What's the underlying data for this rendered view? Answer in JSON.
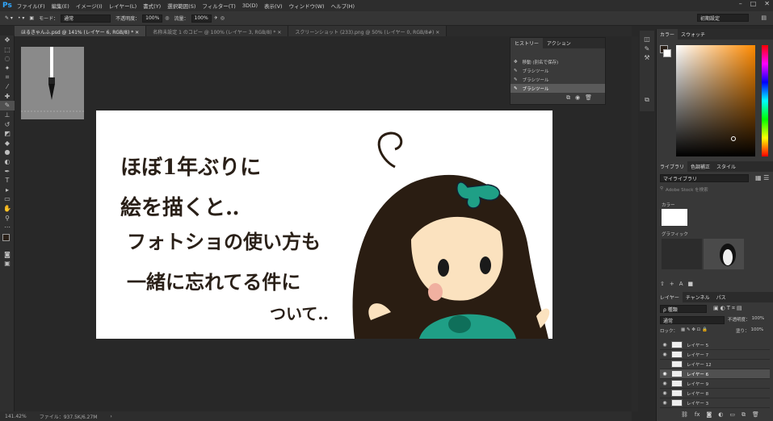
{
  "app": {
    "logo": "Ps"
  },
  "menu": [
    "ファイル(F)",
    "編集(E)",
    "イメージ(I)",
    "レイヤー(L)",
    "書式(Y)",
    "選択範囲(S)",
    "フィルター(T)",
    "3D(D)",
    "表示(V)",
    "ウィンドウ(W)",
    "ヘルプ(H)"
  ],
  "window_controls": [
    "–",
    "□",
    "✕"
  ],
  "options": {
    "mode_label": "モード：",
    "mode_value": "通常",
    "opacity_label": "不透明度：",
    "opacity_value": "100%",
    "flow_label": "流量：",
    "flow_value": "100%",
    "workspace": "初期設定"
  },
  "tabs": [
    "ほるきゃんふ.psd @ 141% (レイヤー 6, RGB/8) * ✕",
    "名称未設定 1 のコピー @ 100% (レイヤー 3, RGB/8) * ✕",
    "スクリーンショット (233).png @ 50% (レイヤー 0, RGB/8#) ✕"
  ],
  "canvas_text": {
    "line1": "ほぼ1年ぶりに",
    "line2": "絵を描くと‥",
    "line3": "フォトショの使い方も",
    "line4": "一緒に忘れてる件に",
    "line5": "ついて‥"
  },
  "history_panel": {
    "tabs": [
      "ヒストリー",
      "アクション"
    ],
    "items": [
      "移動 (別名で保存)",
      "ブラシツール",
      "ブラシツール",
      "ブラシツール"
    ]
  },
  "color_panel": {
    "tabs": [
      "カラー",
      "スウォッチ"
    ],
    "foreground": "#2a2018",
    "background": "#ffffff"
  },
  "library_panel": {
    "tabs": [
      "ライブラリ",
      "色調補正",
      "スタイル"
    ],
    "library": "マイライブラリ",
    "search_placeholder": "Adobe Stock を検索",
    "colors_label": "カラー",
    "graphics_label": "グラフィック"
  },
  "layers_panel": {
    "tabs": [
      "レイヤー",
      "チャンネル",
      "パス"
    ],
    "filter": "ρ 種類",
    "blend": "通常",
    "opacity_label": "不透明度：",
    "opacity_value": "100%",
    "lock_label": "ロック：",
    "fill_label": "塗り：",
    "fill_value": "100%",
    "layers": [
      "レイヤー 5",
      "レイヤー 7",
      "レイヤー 12",
      "レイヤー 6",
      "レイヤー 9",
      "レイヤー 8",
      "レイヤー 3"
    ]
  },
  "status": {
    "zoom": "141.42%",
    "file": "ファイル：937.5K/6.27M"
  }
}
